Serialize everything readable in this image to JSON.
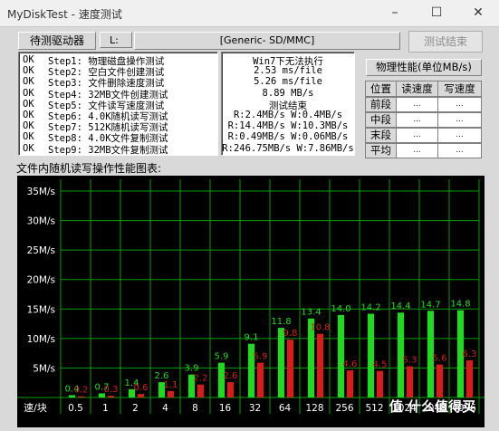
{
  "window": {
    "title": "MyDiskTest - 速度测试",
    "minimize": "–",
    "maximize": "☐",
    "close": "✕"
  },
  "toolbar": {
    "drive_label": "待测驱动器",
    "drive_letter": "L:",
    "device_name": "[Generic- SD/MMC]",
    "end_button": "测试结束"
  },
  "steps": [
    {
      "status": "OK",
      "text": "Step1: 物理磁盘操作测试"
    },
    {
      "status": "OK",
      "text": "Step2: 空白文件创建测试"
    },
    {
      "status": "OK",
      "text": "Step3: 文件删除速度测试"
    },
    {
      "status": "OK",
      "text": "Step4: 32MB文件创建测试"
    },
    {
      "status": "OK",
      "text": "Step5: 文件读写速度测试"
    },
    {
      "status": "OK",
      "text": "Step6: 4.0K随机读写测试"
    },
    {
      "status": "OK",
      "text": "Step7: 512K随机读写测试"
    },
    {
      "status": "OK",
      "text": "Step8: 4.0K文件复制测试"
    },
    {
      "status": "OK",
      "text": "Step9: 32MB文件复制测试"
    }
  ],
  "results": [
    "Win7下无法执行",
    "2.53 ms/file",
    "5.26 ms/file",
    "8.89 MB/s",
    "测试结束",
    "R:2.4MB/s W:0.4MB/s",
    "R:14.4MB/s W:10.3MB/s",
    "R:0.49MB/s W:0.06MB/s",
    "R:246.75MB/s W:7.86MB/s"
  ],
  "performance": {
    "title": "物理性能(单位MB/s)",
    "headers": [
      "位置",
      "读速度",
      "写速度"
    ],
    "rows": [
      {
        "label": "前段",
        "read": "...",
        "write": "..."
      },
      {
        "label": "中段",
        "read": "...",
        "write": "..."
      },
      {
        "label": "末段",
        "read": "...",
        "write": "..."
      },
      {
        "label": "平均",
        "read": "...",
        "write": "..."
      }
    ]
  },
  "chart_section_label": "文件内随机读写操作性能图表:",
  "watermark": "值 什么值得买",
  "colors": {
    "read": "#18e018",
    "write": "#e01818",
    "grid": "#00a000",
    "background": "#000000"
  },
  "chart_data": {
    "type": "bar",
    "x_axis_label": "速/块",
    "categories": [
      "0.5",
      "1",
      "2",
      "4",
      "8",
      "16",
      "32",
      "64",
      "128",
      "256",
      "512",
      "1024",
      "2048",
      "4096"
    ],
    "y_ticks": [
      "5M/s",
      "10M/s",
      "15M/s",
      "20M/s",
      "25M/s",
      "30M/s",
      "35M/s"
    ],
    "ylim": [
      0,
      37
    ],
    "series": [
      {
        "values": [
          0.4,
          0.7,
          1.4,
          2.6,
          3.9,
          5.9,
          9.1,
          11.8,
          13.4,
          14.0,
          14.2,
          14.4,
          14.7,
          14.8
        ],
        "labels": [
          "0.4",
          "0.7",
          "1.4",
          "2.6",
          "3.9",
          "5.9",
          "9.1",
          "11.8",
          "13.4",
          "14.0",
          "14.2",
          "14.4",
          "14.7",
          "14.8"
        ]
      },
      {
        "values": [
          0.2,
          0.3,
          0.6,
          1.1,
          2.2,
          2.6,
          5.9,
          9.8,
          10.8,
          4.6,
          4.5,
          5.3,
          5.6,
          6.3
        ],
        "labels": [
          "0.2",
          "0.3",
          "0.6",
          "1.1",
          "2.2",
          "2.6",
          "5.9",
          "9.8",
          "10.8",
          "4.6",
          "4.5",
          "5.3",
          "5.6",
          "6.3"
        ]
      }
    ]
  }
}
